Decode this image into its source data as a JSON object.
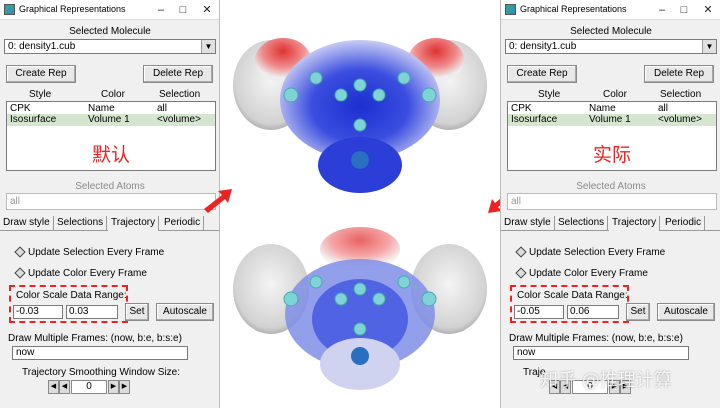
{
  "window": {
    "title": "Graphical Representations"
  },
  "panels": {
    "left": {
      "selected_molecule_label": "Selected Molecule",
      "molecule": "0: density1.cub",
      "create_rep": "Create Rep",
      "delete_rep": "Delete Rep",
      "columns": [
        "Style",
        "Color",
        "Selection"
      ],
      "reps": [
        {
          "style": "CPK",
          "color": "Name",
          "selection": "all"
        },
        {
          "style": "Isosurface",
          "color": "Volume 1",
          "selection": "<volume>"
        }
      ],
      "annotation": "默认",
      "selected_atoms_label": "Selected Atoms",
      "selected_atoms_value": "all",
      "tabs": [
        "Draw style",
        "Selections",
        "Trajectory",
        "Periodic"
      ],
      "update_selection": "Update Selection Every Frame",
      "update_color": "Update Color Every Frame",
      "color_scale_label": "Color Scale Data Range:",
      "range_min": "-0.03",
      "range_max": "0.03",
      "set": "Set",
      "autoscale": "Autoscale",
      "frames_label": "Draw Multiple Frames: (now, b:e, b:s:e)",
      "frames_value": "now",
      "smoothing_label": "Trajectory Smoothing Window Size:",
      "smoothing_value": "0"
    },
    "right": {
      "selected_molecule_label": "Selected Molecule",
      "molecule": "0: density1.cub",
      "create_rep": "Create Rep",
      "delete_rep": "Delete Rep",
      "columns": [
        "Style",
        "Color",
        "Selection"
      ],
      "reps": [
        {
          "style": "CPK",
          "color": "Name",
          "selection": "all"
        },
        {
          "style": "Isosurface",
          "color": "Volume 1",
          "selection": "<volume>"
        }
      ],
      "annotation": "实际",
      "selected_atoms_label": "Selected Atoms",
      "selected_atoms_value": "all",
      "tabs": [
        "Draw style",
        "Selections",
        "Trajectory",
        "Periodic"
      ],
      "update_selection": "Update Selection Every Frame",
      "update_color": "Update Color Every Frame",
      "color_scale_label": "Color Scale Data Range:",
      "range_min": "-0.05",
      "range_max": "0.06",
      "set": "Set",
      "autoscale": "Autoscale",
      "frames_label": "Draw Multiple Frames: (now, b:e, b:s:e)",
      "frames_value": "now",
      "smoothing_label": "Traje",
      "smoothing_value": "0"
    }
  },
  "watermark": "知乎 @推理计算",
  "colors": {
    "annotation": "#ee2222",
    "selected_row": "#d4e6cf",
    "positive_potential": "#1a2fd0",
    "negative_potential": "#e02020"
  }
}
